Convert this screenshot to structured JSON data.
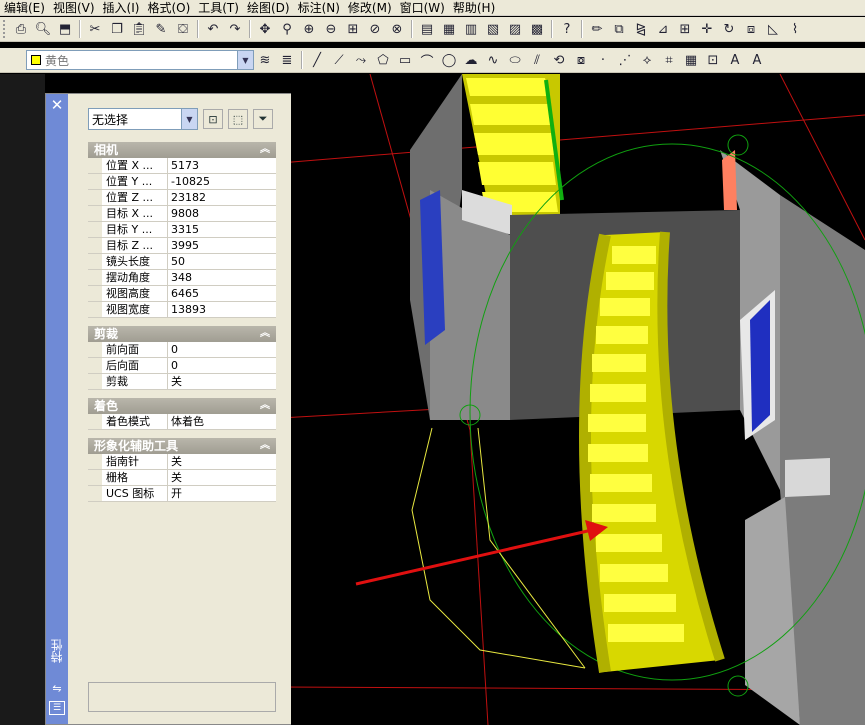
{
  "menu": {
    "items": [
      {
        "label": "编辑(E)"
      },
      {
        "label": "视图(V)"
      },
      {
        "label": "插入(I)"
      },
      {
        "label": "格式(O)"
      },
      {
        "label": "工具(T)"
      },
      {
        "label": "绘图(D)"
      },
      {
        "label": "标注(N)"
      },
      {
        "label": "修改(M)"
      },
      {
        "label": "窗口(W)"
      },
      {
        "label": "帮助(H)"
      }
    ]
  },
  "toolbar2": {
    "color_value": "黄色",
    "color_swatch": "#ffff00",
    "text_style_glyph": "A",
    "text_glyph": "A"
  },
  "palette": {
    "title": "特性",
    "selection": "无选择",
    "sections": {
      "camera": {
        "title": "相机",
        "rows": [
          {
            "name": "位置 X ...",
            "value": "5173"
          },
          {
            "name": "位置 Y ...",
            "value": "-10825"
          },
          {
            "name": "位置 Z ...",
            "value": "23182"
          },
          {
            "name": "目标 X ...",
            "value": "9808"
          },
          {
            "name": "目标 Y ...",
            "value": "3315"
          },
          {
            "name": "目标 Z ...",
            "value": "3995"
          },
          {
            "name": "镜头长度",
            "value": "50"
          },
          {
            "name": "摆动角度",
            "value": "348"
          },
          {
            "name": "视图高度",
            "value": "6465"
          },
          {
            "name": "视图宽度",
            "value": "13893"
          }
        ]
      },
      "clip": {
        "title": "剪裁",
        "rows": [
          {
            "name": "前向面",
            "value": "0"
          },
          {
            "name": "后向面",
            "value": "0"
          },
          {
            "name": "剪裁",
            "value": "关"
          }
        ]
      },
      "shade": {
        "title": "着色",
        "rows": [
          {
            "name": "着色模式",
            "value": "体着色"
          }
        ]
      },
      "visual": {
        "title": "形象化辅助工具",
        "rows": [
          {
            "name": "指南针",
            "value": "关"
          },
          {
            "name": "栅格",
            "value": "关"
          },
          {
            "name": "UCS 图标",
            "value": "开"
          }
        ]
      }
    }
  },
  "colors": {
    "stair_yellow": "#ffff00",
    "wall_gray": "#5a5a5a",
    "arrow_red": "#e01010",
    "palette_title": "#6f8ad6"
  }
}
